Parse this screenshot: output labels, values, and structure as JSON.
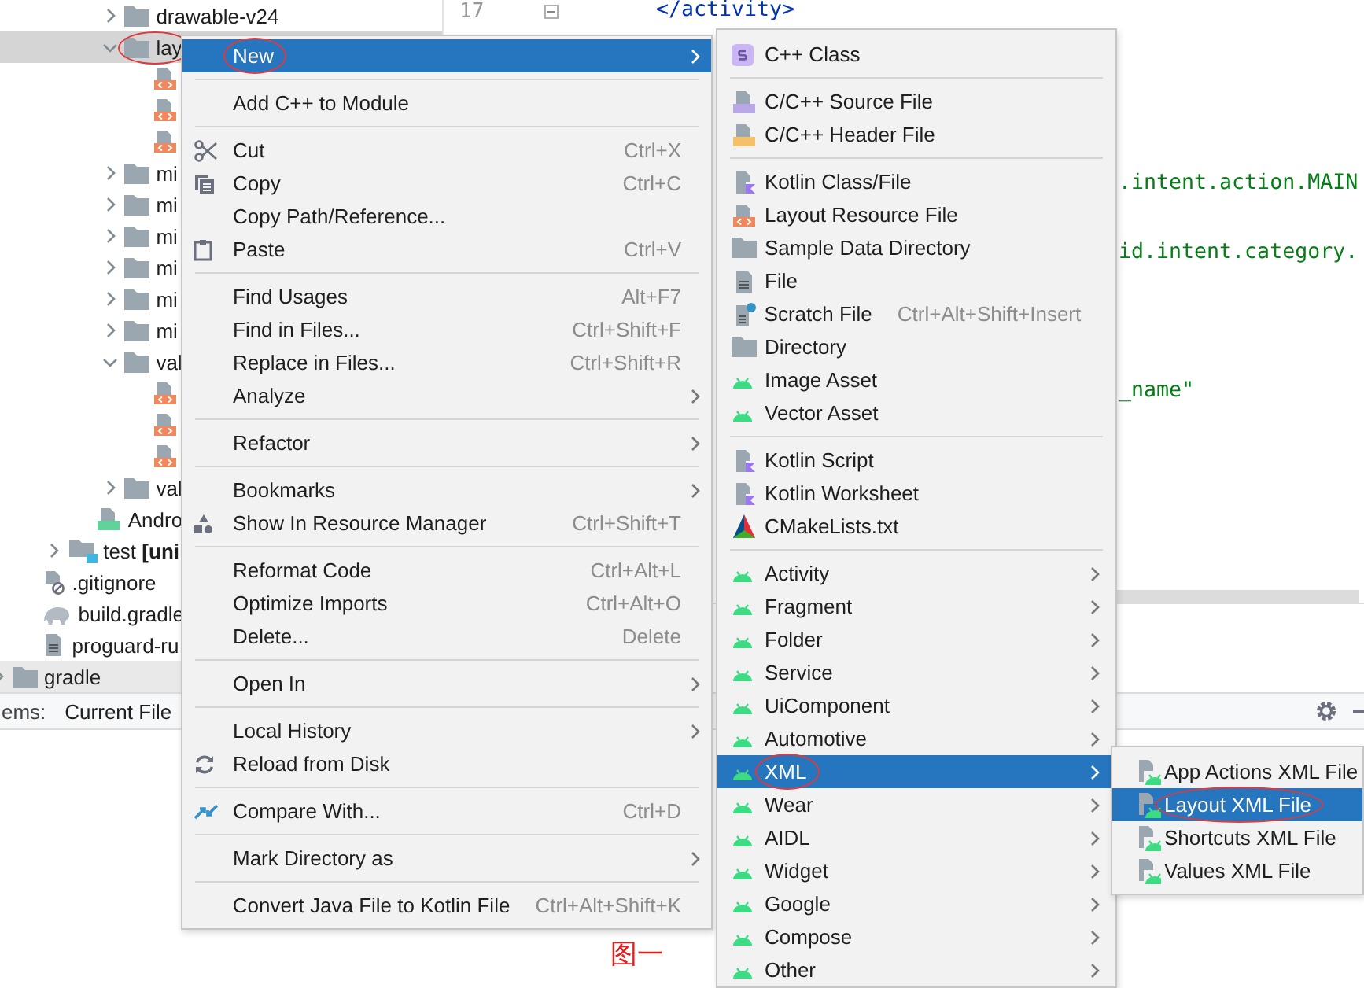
{
  "project_tree": {
    "items": [
      {
        "children": [
          {
            "children": [
              {
                "children": [
                  {
                    "children": [
                      {
                        "label": "drawable-v24",
                        "kind": "folder",
                        "expanded": false,
                        "selected": false
                      },
                      {
                        "label": "lay",
                        "kind": "folder",
                        "expanded": true,
                        "selected": true,
                        "circled": true,
                        "children": [
                          {
                            "kind": "layout-xml",
                            "selected": false
                          },
                          {
                            "kind": "layout-xml",
                            "selected": false
                          },
                          {
                            "kind": "layout-xml",
                            "selected": false
                          }
                        ]
                      },
                      {
                        "label": "mi",
                        "kind": "folder",
                        "expanded": false,
                        "selected": false
                      },
                      {
                        "label": "mi",
                        "kind": "folder",
                        "expanded": false,
                        "selected": false
                      },
                      {
                        "label": "mi",
                        "kind": "folder",
                        "expanded": false,
                        "selected": false
                      },
                      {
                        "label": "mi",
                        "kind": "folder",
                        "expanded": false,
                        "selected": false
                      },
                      {
                        "label": "mi",
                        "kind": "folder",
                        "expanded": false,
                        "selected": false
                      },
                      {
                        "label": "mi",
                        "kind": "folder",
                        "expanded": false,
                        "selected": false
                      },
                      {
                        "label": "val",
                        "kind": "folder",
                        "expanded": true,
                        "selected": false,
                        "children": [
                          {
                            "kind": "layout-xml",
                            "selected": false
                          },
                          {
                            "kind": "layout-xml",
                            "selected": false
                          },
                          {
                            "kind": "layout-xml",
                            "selected": false
                          }
                        ]
                      },
                      {
                        "label": "val",
                        "kind": "folder",
                        "expanded": false,
                        "selected": false
                      }
                    ]
                  },
                  {
                    "label": "Andro",
                    "kind": "manifest",
                    "selected": false
                  }
                ]
              },
              {
                "label": "test **[uni**",
                "kind": "test-folder",
                "expanded": false,
                "selected": false
              }
            ]
          },
          {
            "label": ".gitignore",
            "kind": "ignore-file",
            "selected": false
          },
          {
            "label": "build.gradle",
            "kind": "gradle-file",
            "selected": false
          },
          {
            "label": "proguard-ru",
            "kind": "text-file",
            "selected": false
          }
        ]
      },
      {
        "label": "gradle",
        "kind": "folder",
        "expanded": false,
        "selected": false,
        "hovered": true
      }
    ]
  },
  "editor": {
    "line_number": "17",
    "lines": [
      {
        "text": "</activity>",
        "kind": "tag"
      },
      {
        "text": ".intent.action.MAIN",
        "kind": "string"
      },
      {
        "text": "id.intent.category.",
        "kind": "string"
      },
      {
        "text": "_name\"",
        "kind": "string"
      }
    ]
  },
  "tool_window": {
    "scope_label": "ems:",
    "tab": "Current File"
  },
  "context_menu": {
    "groups": [
      [
        {
          "label": "New",
          "submenu": true,
          "selected": true,
          "circled": true
        }
      ],
      [
        {
          "label": "Add C++ to Module",
          "submenu": false,
          "selected": false
        }
      ],
      [
        {
          "label": "Cut",
          "shortcut": "Ctrl+X",
          "submenu": false,
          "selected": false
        },
        {
          "label": "Copy",
          "shortcut": "Ctrl+C",
          "submenu": false,
          "selected": false
        },
        {
          "label": "Copy Path/Reference...",
          "submenu": false,
          "selected": false
        },
        {
          "label": "Paste",
          "shortcut": "Ctrl+V",
          "submenu": false,
          "selected": false
        }
      ],
      [
        {
          "label": "Find Usages",
          "shortcut": "Alt+F7",
          "submenu": false,
          "selected": false
        },
        {
          "label": "Find in Files...",
          "shortcut": "Ctrl+Shift+F",
          "submenu": false,
          "selected": false
        },
        {
          "label": "Replace in Files...",
          "shortcut": "Ctrl+Shift+R",
          "submenu": false,
          "selected": false
        },
        {
          "label": "Analyze",
          "submenu": true,
          "selected": false
        }
      ],
      [
        {
          "label": "Refactor",
          "submenu": true,
          "selected": false
        }
      ],
      [
        {
          "label": "Bookmarks",
          "submenu": true,
          "selected": false
        },
        {
          "label": "Show In Resource Manager",
          "shortcut": "Ctrl+Shift+T",
          "submenu": false,
          "selected": false
        }
      ],
      [
        {
          "label": "Reformat Code",
          "shortcut": "Ctrl+Alt+L",
          "submenu": false,
          "selected": false
        },
        {
          "label": "Optimize Imports",
          "shortcut": "Ctrl+Alt+O",
          "submenu": false,
          "selected": false
        },
        {
          "label": "Delete...",
          "shortcut": "Delete",
          "submenu": false,
          "selected": false
        }
      ],
      [
        {
          "label": "Open In",
          "submenu": true,
          "selected": false
        }
      ],
      [
        {
          "label": "Local History",
          "submenu": true,
          "selected": false
        },
        {
          "label": "Reload from Disk",
          "submenu": false,
          "selected": false
        }
      ],
      [
        {
          "label": "Compare With...",
          "shortcut": "Ctrl+D",
          "submenu": false,
          "selected": false
        }
      ],
      [
        {
          "label": "Mark Directory as",
          "submenu": true,
          "selected": false
        }
      ],
      [
        {
          "label": "Convert Java File to Kotlin File",
          "shortcut": "Ctrl+Alt+Shift+K",
          "submenu": false,
          "selected": false
        }
      ]
    ]
  },
  "new_submenu": {
    "groups": [
      [
        {
          "label": "C++ Class",
          "submenu": false,
          "selected": false
        }
      ],
      [
        {
          "label": "C/C++ Source File",
          "submenu": false,
          "selected": false
        },
        {
          "label": "C/C++ Header File",
          "submenu": false,
          "selected": false
        }
      ],
      [
        {
          "label": "Kotlin Class/File",
          "submenu": false,
          "selected": false
        },
        {
          "label": "Layout Resource File",
          "submenu": false,
          "selected": false
        },
        {
          "label": "Sample Data Directory",
          "submenu": false,
          "selected": false
        },
        {
          "label": "File",
          "submenu": false,
          "selected": false
        },
        {
          "label": "Scratch File",
          "shortcut": "Ctrl+Alt+Shift+Insert",
          "submenu": false,
          "selected": false
        },
        {
          "label": "Directory",
          "submenu": false,
          "selected": false
        },
        {
          "label": "Image Asset",
          "submenu": false,
          "selected": false
        },
        {
          "label": "Vector Asset",
          "submenu": false,
          "selected": false
        }
      ],
      [
        {
          "label": "Kotlin Script",
          "submenu": false,
          "selected": false
        },
        {
          "label": "Kotlin Worksheet",
          "submenu": false,
          "selected": false
        },
        {
          "label": "CMakeLists.txt",
          "submenu": false,
          "selected": false
        }
      ],
      [
        {
          "label": "Activity",
          "submenu": true,
          "selected": false
        },
        {
          "label": "Fragment",
          "submenu": true,
          "selected": false
        },
        {
          "label": "Folder",
          "submenu": true,
          "selected": false
        },
        {
          "label": "Service",
          "submenu": true,
          "selected": false
        },
        {
          "label": "UiComponent",
          "submenu": true,
          "selected": false
        },
        {
          "label": "Automotive",
          "submenu": true,
          "selected": false
        },
        {
          "label": "XML",
          "submenu": true,
          "selected": true,
          "circled": true
        },
        {
          "label": "Wear",
          "submenu": true,
          "selected": false
        },
        {
          "label": "AIDL",
          "submenu": true,
          "selected": false
        },
        {
          "label": "Widget",
          "submenu": true,
          "selected": false
        },
        {
          "label": "Google",
          "submenu": true,
          "selected": false
        },
        {
          "label": "Compose",
          "submenu": true,
          "selected": false
        },
        {
          "label": "Other",
          "submenu": true,
          "selected": false
        }
      ]
    ]
  },
  "xml_submenu": {
    "groups": [
      [
        {
          "label": "App Actions XML File",
          "selected": false
        },
        {
          "label": "Layout XML File",
          "selected": true,
          "circled": true
        },
        {
          "label": "Shortcuts XML File",
          "selected": false
        },
        {
          "label": "Values XML File",
          "selected": false
        }
      ]
    ]
  },
  "caption": "图一"
}
